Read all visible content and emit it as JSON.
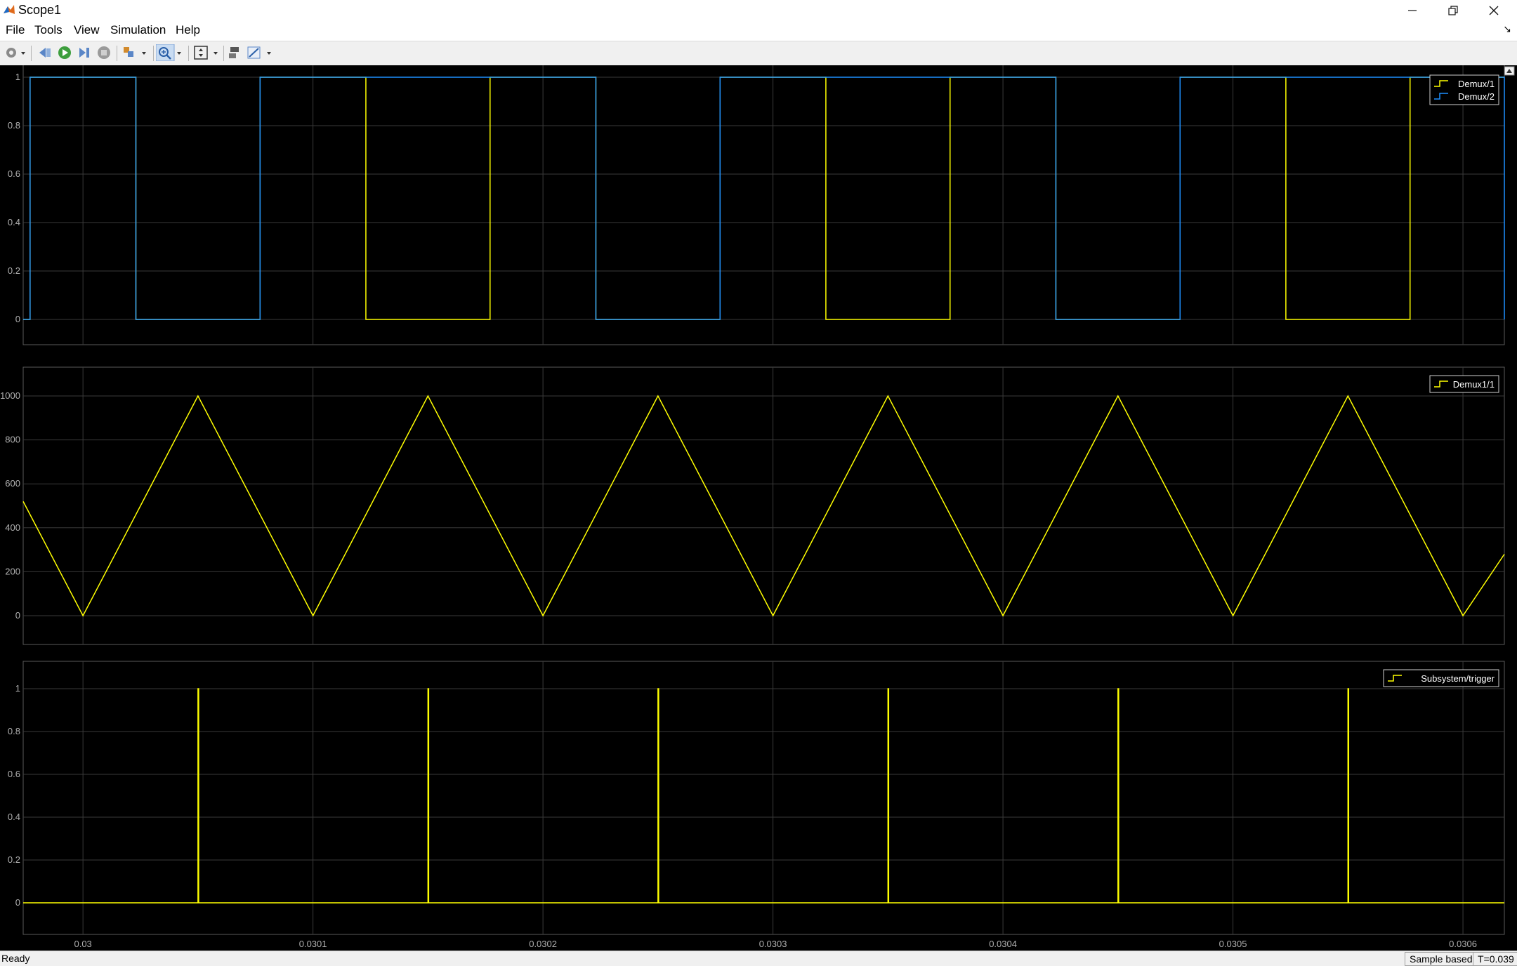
{
  "window": {
    "title": "Scope1"
  },
  "menu": {
    "items": [
      "File",
      "Tools",
      "View",
      "Simulation",
      "Help"
    ]
  },
  "toolbar": {
    "icons": [
      "gear-icon",
      "back-icon",
      "run-icon",
      "step-forward-icon",
      "stop-icon",
      "highlight-icon",
      "zoom-in-icon",
      "fit-to-view-icon",
      "triggers-icon",
      "cursor-measure-icon"
    ]
  },
  "colors": {
    "yellow": "#ffff00",
    "blue": "#1e90ff",
    "grid": "#3a3a3a",
    "tick": "#b0b0b0"
  },
  "status": {
    "left": "Ready",
    "sample": "Sample based",
    "time": "T=0.039"
  },
  "chart_data": [
    {
      "type": "line",
      "legend": [
        "Demux/1",
        "Demux/2"
      ],
      "legend_position": "top-right",
      "ylim": [
        0,
        1
      ],
      "yticks": [
        "0",
        "0.2",
        "0.4",
        "0.6",
        "0.8",
        "1"
      ],
      "xlim": [
        0.029974,
        0.030618
      ],
      "grid": true,
      "series": [
        {
          "name": "Demux/1",
          "color": "yellow",
          "steps": [
            [
              0.029974,
              0
            ],
            [
              0.029977,
              1
            ],
            [
              0.030023,
              0
            ],
            [
              0.030077,
              1
            ],
            [
              0.030123,
              0
            ],
            [
              0.030177,
              1
            ],
            [
              0.030223,
              0
            ],
            [
              0.030277,
              1
            ],
            [
              0.030323,
              0
            ],
            [
              0.030377,
              1
            ],
            [
              0.030423,
              0
            ],
            [
              0.030477,
              1
            ],
            [
              0.030523,
              0
            ],
            [
              0.030577,
              1
            ],
            [
              0.030618,
              1
            ]
          ]
        },
        {
          "name": "Demux/2",
          "color": "blue",
          "steps": [
            [
              0.029974,
              0
            ],
            [
              0.029977,
              1
            ],
            [
              0.030023,
              0
            ],
            [
              0.030077,
              1
            ],
            [
              0.030123,
              1
            ],
            [
              0.030177,
              1
            ],
            [
              0.030223,
              0
            ],
            [
              0.030277,
              1
            ],
            [
              0.030323,
              1
            ],
            [
              0.030377,
              1
            ],
            [
              0.030423,
              0
            ],
            [
              0.030477,
              1
            ],
            [
              0.030523,
              1
            ],
            [
              0.030577,
              1
            ],
            [
              0.030618,
              0
            ]
          ]
        }
      ]
    },
    {
      "type": "line",
      "legend": [
        "Demux1/1"
      ],
      "legend_position": "top-right",
      "ylim": [
        0,
        1000
      ],
      "yticks": [
        "0",
        "200",
        "400",
        "600",
        "800",
        "1000"
      ],
      "xlim": [
        0.029974,
        0.030618
      ],
      "grid": true,
      "series": [
        {
          "name": "Demux1/1",
          "color": "yellow",
          "points": [
            [
              0.029974,
              520
            ],
            [
              0.03,
              0
            ],
            [
              0.03005,
              1000
            ],
            [
              0.0301,
              0
            ],
            [
              0.03015,
              1000
            ],
            [
              0.0302,
              0
            ],
            [
              0.03025,
              1000
            ],
            [
              0.0303,
              0
            ],
            [
              0.03035,
              1000
            ],
            [
              0.0304,
              0
            ],
            [
              0.03045,
              1000
            ],
            [
              0.0305,
              0
            ],
            [
              0.03055,
              1000
            ],
            [
              0.0306,
              0
            ],
            [
              0.030618,
              280
            ]
          ]
        }
      ]
    },
    {
      "type": "line",
      "legend": [
        "Subsystem/trigger"
      ],
      "legend_position": "top-right",
      "ylim": [
        0,
        1
      ],
      "yticks": [
        "0",
        "0.2",
        "0.4",
        "0.6",
        "0.8",
        "1"
      ],
      "xlim": [
        0.029974,
        0.030618
      ],
      "xticks": [
        "0.03",
        "0.0301",
        "0.0302",
        "0.0303",
        "0.0304",
        "0.0305",
        "0.0306"
      ],
      "grid": true,
      "series": [
        {
          "name": "Subsystem/trigger",
          "color": "yellow",
          "pulses_at": [
            0.03005,
            0.03015,
            0.03025,
            0.03035,
            0.03045,
            0.03055
          ]
        }
      ]
    }
  ]
}
